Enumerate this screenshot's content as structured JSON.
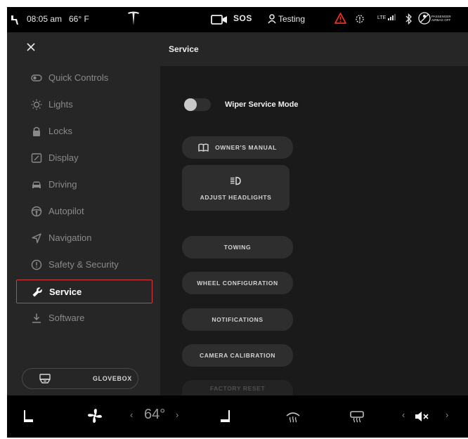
{
  "status": {
    "time": "08:05 am",
    "temperature": "66° F",
    "sos": "SOS",
    "profile": "Testing",
    "network": "LTE",
    "airbag_text": "PASSENGER AIRBAG OFF"
  },
  "sidebar": {
    "items": [
      {
        "label": "Quick Controls",
        "icon": "quick-controls-icon"
      },
      {
        "label": "Lights",
        "icon": "light-bulb-icon"
      },
      {
        "label": "Locks",
        "icon": "lock-icon"
      },
      {
        "label": "Display",
        "icon": "display-icon"
      },
      {
        "label": "Driving",
        "icon": "car-icon"
      },
      {
        "label": "Autopilot",
        "icon": "steering-wheel-icon"
      },
      {
        "label": "Navigation",
        "icon": "navigation-arrow-icon"
      },
      {
        "label": "Safety & Security",
        "icon": "alert-circle-icon"
      },
      {
        "label": "Service",
        "icon": "wrench-icon",
        "active": true
      },
      {
        "label": "Software",
        "icon": "download-icon"
      }
    ],
    "glovebox_label": "GLOVEBOX"
  },
  "main": {
    "title": "Service",
    "wiper_label": "Wiper Service Mode",
    "wiper_on": false,
    "buttons": {
      "owners_manual": "OWNER'S MANUAL",
      "adjust_headlights": "ADJUST HEADLIGHTS",
      "towing": "TOWING",
      "wheel_configuration": "WHEEL CONFIGURATION",
      "notifications": "NOTIFICATIONS",
      "camera_calibration": "CAMERA CALIBRATION",
      "factory_reset": "FACTORY RESET"
    }
  },
  "bottom": {
    "cabin_temp": "64",
    "temp_unit": "°",
    "decrease_arrow": "‹",
    "increase_arrow": "›"
  },
  "colors": {
    "accent_red": "#d93d3d",
    "warning_red": "#e5332a",
    "background": "#1a1a1a",
    "sidebar": "#262626"
  }
}
